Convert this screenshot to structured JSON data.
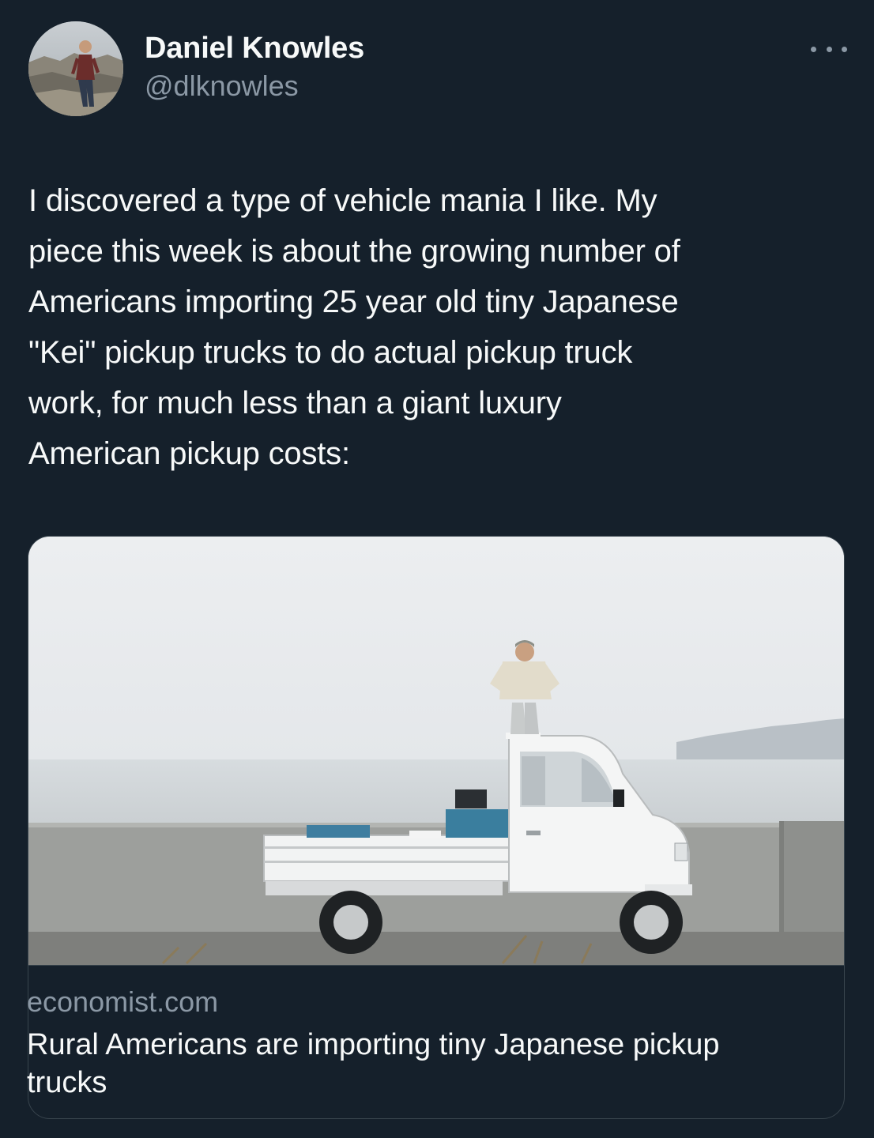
{
  "author": {
    "display_name": "Daniel Knowles",
    "handle": "@dlknowles",
    "avatar_icon": "profile-photo"
  },
  "more_icon": "more-horizontal-icon",
  "tweet": {
    "text": "I discovered a type of vehicle mania I like. My\npiece this week is about the growing number of\nAmericans importing 25 year old tiny Japanese\n\"Kei\" pickup trucks to do actual pickup truck\nwork, for much less than a giant luxury\nAmerican pickup costs:"
  },
  "link_card": {
    "domain": "economist.com",
    "title": "Rural Americans are importing tiny Japanese pickup trucks",
    "image_icon": "kei-truck-photo"
  },
  "colors": {
    "background": "#15202b",
    "primary_text": "#f7f9f9",
    "secondary_text": "#8b98a5",
    "border": "#38444d"
  }
}
